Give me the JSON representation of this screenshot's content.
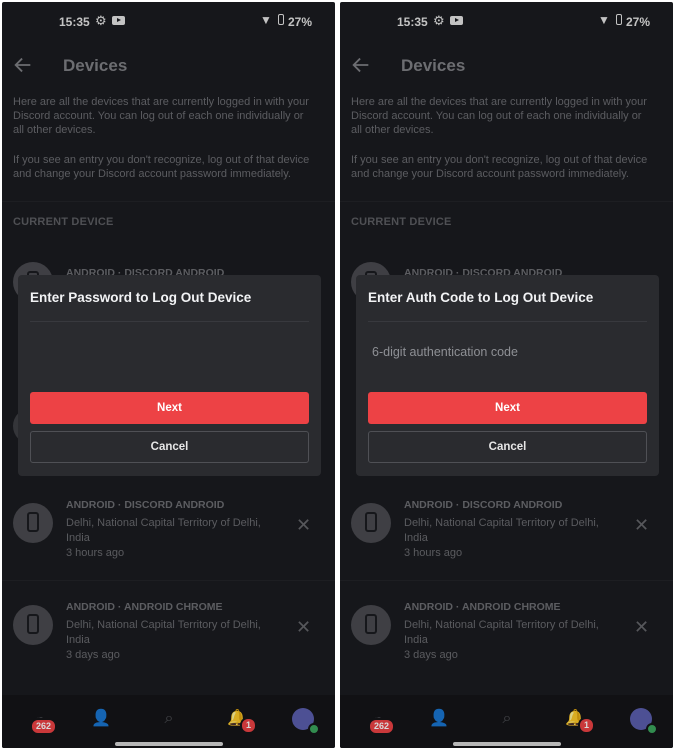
{
  "status": {
    "time": "15:35",
    "battery": "27%"
  },
  "header": {
    "title": "Devices"
  },
  "intro": {
    "p1": "Here are all the devices that are currently logged in with your Discord account. You can log out of each one individually or all other devices.",
    "p2": "If you see an entry you don't recognize, log out of that device and change your Discord account password immediately."
  },
  "section": {
    "current": "CURRENT DEVICE"
  },
  "peek": {
    "device_title": "ANDROID · DISCORD ANDROID"
  },
  "devices": [
    {
      "title": "ANDROID · DISCORD ANDROID",
      "location": "Delhi, National Capital Territory of Delhi, India",
      "time": "3 hours ago"
    },
    {
      "title": "ANDROID · ANDROID CHROME",
      "location": "Delhi, National Capital Territory of Delhi, India",
      "time": "3 days ago"
    }
  ],
  "modal_left": {
    "title": "Enter Password to Log Out Device",
    "placeholder": "",
    "next": "Next",
    "cancel": "Cancel"
  },
  "modal_right": {
    "title": "Enter Auth Code to Log Out Device",
    "placeholder": "6-digit authentication code",
    "next": "Next",
    "cancel": "Cancel"
  },
  "nav": {
    "servers_badge": "262",
    "notif_badge": "1"
  },
  "colors": {
    "accent": "#ed4245",
    "background": "#1b1c20",
    "modal": "#2a2b2f"
  }
}
